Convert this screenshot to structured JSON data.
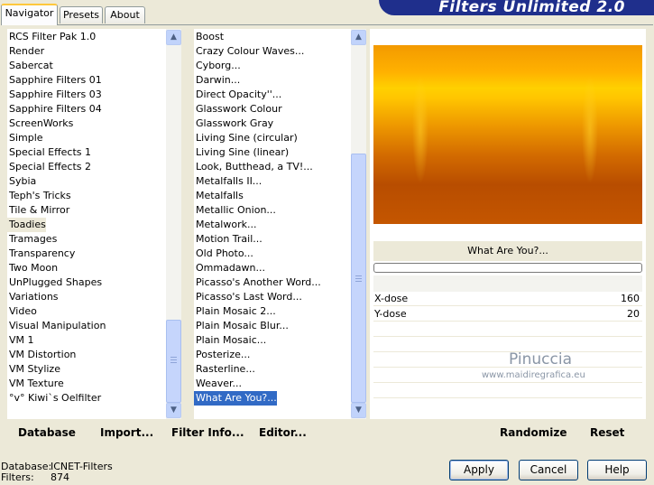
{
  "app_title": "Filters Unlimited 2.0",
  "tabs": [
    {
      "label": "Navigator"
    },
    {
      "label": "Presets"
    },
    {
      "label": "About"
    }
  ],
  "categories": [
    "RCS Filter Pak 1.0",
    "Render",
    "Sabercat",
    "Sapphire Filters 01",
    "Sapphire Filters 03",
    "Sapphire Filters 04",
    "ScreenWorks",
    "Simple",
    "Special Effects 1",
    "Special Effects 2",
    "Sybia",
    "Teph's Tricks",
    "Tile & Mirror",
    "Toadies",
    "Tramages",
    "Transparency",
    "Two Moon",
    "UnPlugged Shapes",
    "Variations",
    "Video",
    "Visual Manipulation",
    "VM 1",
    "VM Distortion",
    "VM Stylize",
    "VM Texture",
    "°v° Kiwi`s Oelfilter"
  ],
  "filters": [
    "Boost",
    "Crazy Colour Waves...",
    "Cyborg...",
    "Darwin...",
    "Direct Opacity''...",
    "Glasswork Colour",
    "Glasswork Gray",
    "Living Sine (circular)",
    "Living Sine (linear)",
    "Look, Butthead, a TV!...",
    "Metalfalls II...",
    "Metalfalls",
    "Metallic Onion...",
    "Metalwork...",
    "Motion Trail...",
    "Old Photo...",
    "Ommadawn...",
    "Picasso's Another Word...",
    "Picasso's Last Word...",
    "Plain Mosaic 2...",
    "Plain Mosaic Blur...",
    "Plain Mosaic...",
    "Posterize...",
    "Rasterline...",
    "Weaver...",
    "What Are You?..."
  ],
  "left_buttons": {
    "database": "Database",
    "import": "Import...",
    "filter_info": "Filter Info...",
    "editor": "Editor..."
  },
  "right_buttons": {
    "randomize": "Randomize",
    "reset": "Reset"
  },
  "preview": {
    "filter_name": "What Are You?..."
  },
  "params": [
    {
      "label": "X-dose",
      "value": "160"
    },
    {
      "label": "Y-dose",
      "value": "20"
    }
  ],
  "watermark": {
    "name": "Pinuccia",
    "site": "www.maidiregrafica.eu"
  },
  "status": {
    "database_label": "Database:",
    "database_value": "ICNET-Filters",
    "filters_label": "Filters:",
    "filters_value": "874"
  },
  "dialog_buttons": {
    "apply": "Apply",
    "cancel": "Cancel",
    "help": "Help"
  },
  "colors": {
    "banner": "#1f2f8c",
    "selection": "#316ac5"
  }
}
